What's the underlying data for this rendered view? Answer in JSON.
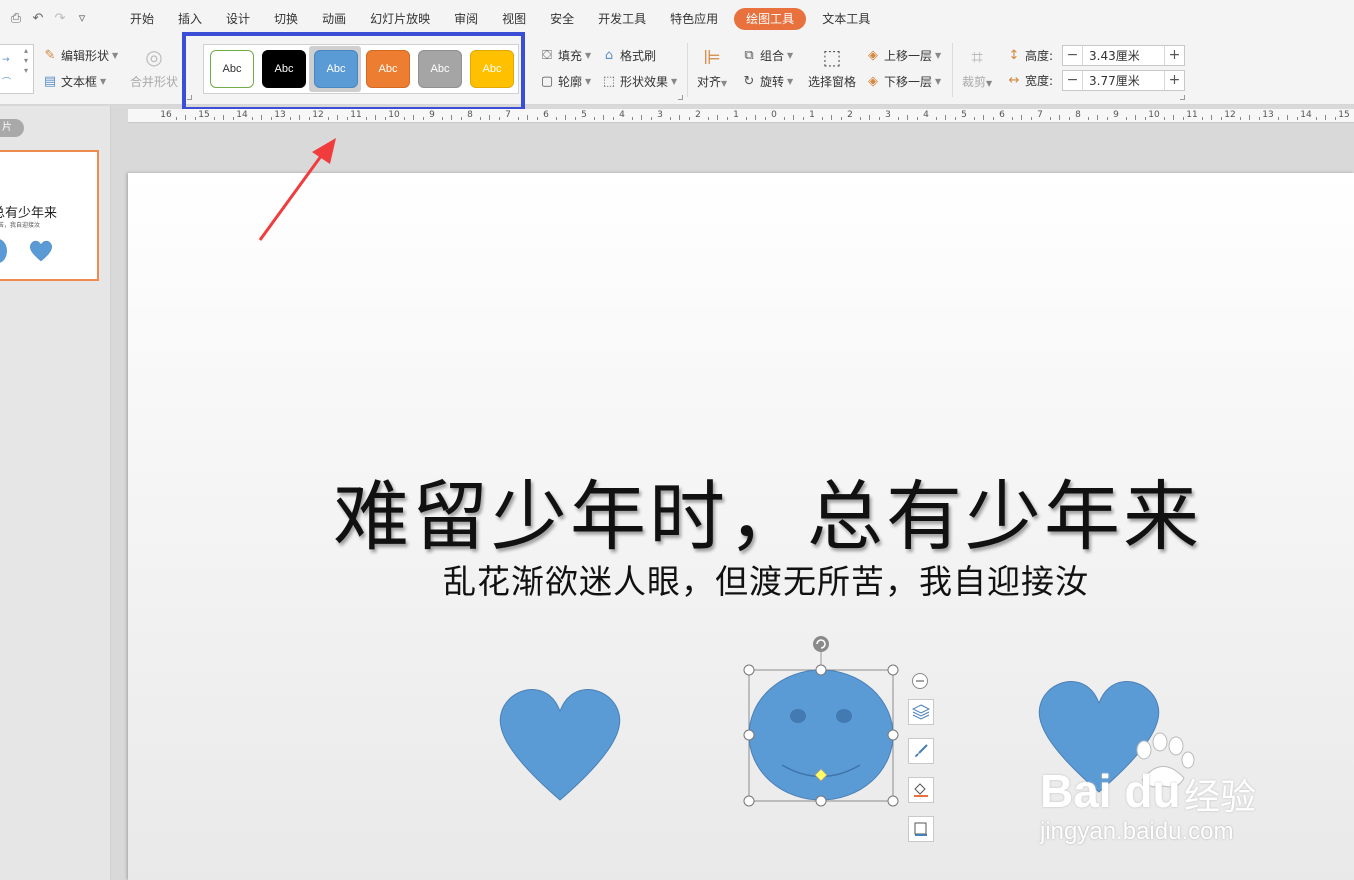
{
  "menubar": {
    "tabs": [
      "开始",
      "插入",
      "设计",
      "切换",
      "动画",
      "幻灯片放映",
      "审阅",
      "视图",
      "安全",
      "开发工具",
      "特色应用",
      "绘图工具",
      "文本工具"
    ],
    "active_tab": "绘图工具",
    "active_color": "#e8713d"
  },
  "ribbon": {
    "edit_shape": "编辑形状",
    "text_box": "文本框",
    "merge_shapes": "合并形状",
    "style_gallery": [
      {
        "label": "Abc",
        "fill": "#ffffff",
        "text": "#333333",
        "border": "#70ad47"
      },
      {
        "label": "Abc",
        "fill": "#000000",
        "text": "#ffffff",
        "border": "#000000"
      },
      {
        "label": "Abc",
        "fill": "#5b9bd5",
        "text": "#ffffff",
        "border": "#4a86c0"
      },
      {
        "label": "Abc",
        "fill": "#ed7d31",
        "text": "#ffffff",
        "border": "#d46a22"
      },
      {
        "label": "Abc",
        "fill": "#a5a5a5",
        "text": "#ffffff",
        "border": "#909090"
      },
      {
        "label": "Abc",
        "fill": "#ffc000",
        "text": "#ffffff",
        "border": "#e0a800"
      }
    ],
    "highlight_color": "#3a4fd6",
    "fill": "填充",
    "format_painter": "格式刷",
    "outline": "轮廓",
    "shape_effects": "形状效果",
    "align": "对齐",
    "group": "组合",
    "rotate": "旋转",
    "selection_pane": "选择窗格",
    "bring_forward": "上移一层",
    "send_backward": "下移一层",
    "crop": "裁剪",
    "height_label": "高度:",
    "height_value": "3.43厘米",
    "width_label": "宽度:",
    "width_value": "3.77厘米"
  },
  "left_panel": {
    "tab_label": "片",
    "thumb_title": "总有少年来",
    "thumb_subtitle": "苦，我自迎接汝"
  },
  "ruler": {
    "labels": [
      "16",
      "15",
      "14",
      "13",
      "12",
      "11",
      "10",
      "9",
      "8",
      "7",
      "6",
      "5",
      "4",
      "3",
      "2",
      "1",
      "0",
      "1",
      "2",
      "3",
      "4",
      "5",
      "6",
      "7",
      "8",
      "9",
      "10",
      "11",
      "12",
      "13",
      "14",
      "15"
    ]
  },
  "slide": {
    "title": "难留少年时，总有少年来",
    "subtitle": "乱花渐欲迷人眼，但渡无所苦，我自迎接汝",
    "shape_color": "#5b9bd5",
    "shape_stroke": "#4a7fb5"
  },
  "watermark": {
    "logo": "Bai du",
    "cn": "经验",
    "url": "jingyan.baidu.com"
  },
  "annotation": {
    "arrow_color": "#f03c3c"
  }
}
